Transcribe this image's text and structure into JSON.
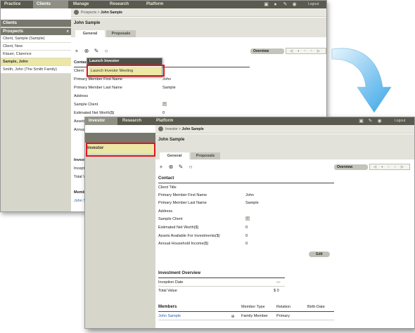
{
  "back_window": {
    "nav": [
      "Practice",
      "Clients",
      "Manage",
      "Research",
      "Platform"
    ],
    "logout": "Logout",
    "sidebar": {
      "clients_header": "Clients",
      "prospects_header": "Prospects",
      "items": [
        "Client, Sample (Sample)",
        "Client, New",
        "Klauer, Clarence",
        "Sample, John",
        "Smith, John (The Smith Family)"
      ]
    },
    "breadcrumb": {
      "parent": "Prospects",
      "current": "John Sample"
    },
    "title": "John Sample",
    "tabs": [
      "General",
      "Proposals"
    ],
    "overview_label": "Overview",
    "popup": {
      "header": "Launch Investor",
      "item": "Launch Investor Meeting"
    },
    "contact_partial": "Contact",
    "fields": {
      "client": "Client",
      "first_name_label": "Primary Member First Name",
      "first_name_value": "John",
      "last_name_label": "Primary Member Last Name",
      "last_name_value": "Sample",
      "address": "Address",
      "sample_client": "Sample Client",
      "net_worth_label": "Estimated Net Worth($)",
      "net_worth_value": "0",
      "assets_partial": "Assets",
      "annual_partial": "Annua"
    },
    "investment_partial": "Investm",
    "inception_partial": "Inceptio",
    "total_partial": "Total V",
    "members_partial": "Memb",
    "member_link_partial": "John S"
  },
  "front_window": {
    "nav": [
      "Investor",
      "Research",
      "Platform"
    ],
    "logout": "Logout",
    "sidebar_item": "Investor",
    "breadcrumb": {
      "parent": "Investor",
      "current": "John Sample"
    },
    "title": "John Sample",
    "tabs": [
      "General",
      "Proposals"
    ],
    "overview_label": "Overview",
    "contact": {
      "header": "Contact",
      "client_title": "Client Title",
      "first_name_label": "Primary Member First Name",
      "first_name_value": "John",
      "last_name_label": "Primary Member Last Name",
      "last_name_value": "Sample",
      "address": "Address",
      "sample_client": "Sample Client",
      "net_worth_label": "Estimated Net Worth($)",
      "net_worth_value": "0",
      "assets_label": "Assets Available For Investments($)",
      "assets_value": "0",
      "income_label": "Annual Household Income($)",
      "income_value": "0",
      "edit_label": "Edit"
    },
    "investment": {
      "header": "Investment Overview",
      "inception_label": "Inception Date",
      "inception_value": "—",
      "total_label": "Total Value",
      "total_value": "$ 0"
    },
    "members": {
      "headers": [
        "Members",
        "Member Type",
        "Relation",
        "Birth-Date"
      ],
      "row": {
        "name": "John Sample",
        "type": "Family Member",
        "relation": "Primary",
        "birth": ""
      }
    }
  },
  "colors": {
    "highlight": "#e0141e",
    "arrow": "#3aa6e8",
    "selected": "#ece7a6"
  }
}
